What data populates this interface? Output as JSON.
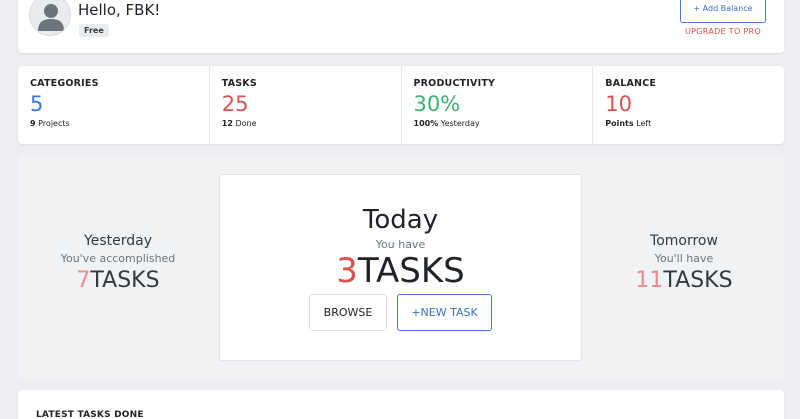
{
  "header": {
    "greeting": "Hello, FBK!",
    "plan": "Free",
    "add_balance_label": "+ Add Balance",
    "upgrade_label": "UPGRADE TO PRO"
  },
  "stats": [
    {
      "label": "CATEGORIES",
      "value": "5",
      "sub_strong": "9",
      "sub_text": "Projects",
      "color": "#3c78d8"
    },
    {
      "label": "TASKS",
      "value": "25",
      "sub_strong": "12",
      "sub_text": "Done",
      "color": "#d9534f"
    },
    {
      "label": "PRODUCTIVITY",
      "value": "30%",
      "sub_strong": "100%",
      "sub_text": "Yesterday",
      "color": "#3bb273"
    },
    {
      "label": "BALANCE",
      "value": "10",
      "sub_strong": "Points",
      "sub_text": "Left",
      "color": "#d9534f"
    }
  ],
  "yesterday": {
    "title": "Yesterday",
    "subtitle": "You've accomplished",
    "count": "7",
    "unit": "TASKS"
  },
  "today": {
    "title": "Today",
    "subtitle": "You have",
    "count": "3",
    "unit": "TASKS",
    "browse_label": "BROWSE",
    "new_task_label": "+NEW TASK"
  },
  "tomorrow": {
    "title": "Tomorrow",
    "subtitle": "You'll have",
    "count": "11",
    "unit": "TASKS"
  },
  "latest": {
    "title": "LATEST TASKS DONE"
  },
  "icons": {
    "avatar": "user-avatar-icon"
  }
}
